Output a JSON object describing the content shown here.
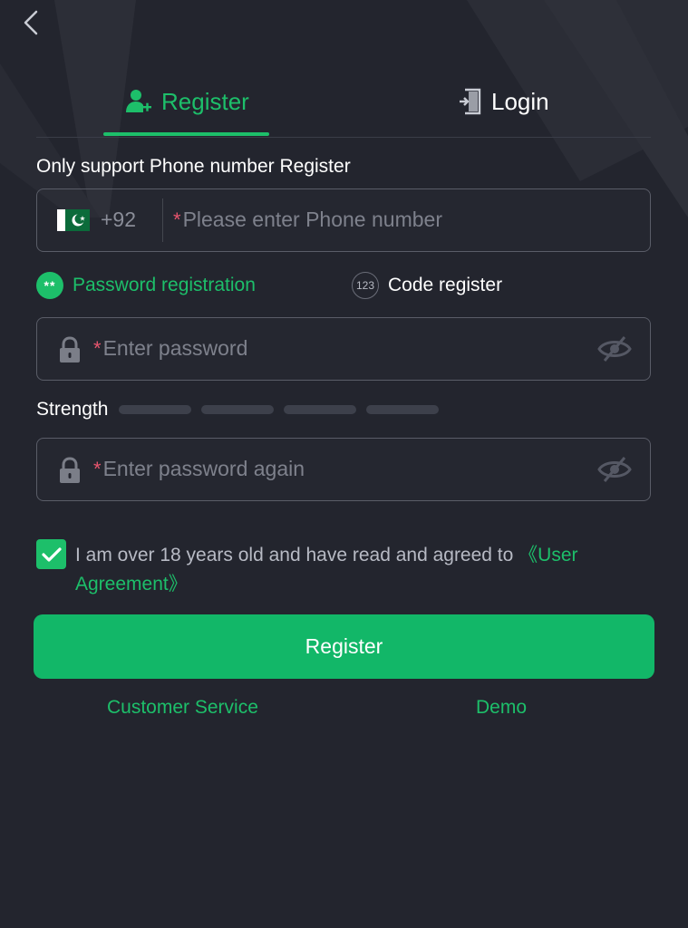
{
  "header": {
    "back_icon": "chevron-left-icon"
  },
  "tabs": [
    {
      "label": "Register",
      "icon": "user-add-icon",
      "active": true
    },
    {
      "label": "Login",
      "icon": "login-door-icon",
      "active": false
    }
  ],
  "form": {
    "support_text": "Only support Phone number Register",
    "phone": {
      "country_flag": "pakistan-flag-icon",
      "country_code": "+92",
      "required_mark": "*",
      "placeholder": "Please enter Phone number"
    },
    "modes": [
      {
        "label": "Password registration",
        "icon_text": "**",
        "selected": true
      },
      {
        "label": "Code register",
        "icon_text": "123",
        "selected": false
      }
    ],
    "password": {
      "required_mark": "*",
      "placeholder": "Enter password"
    },
    "strength": {
      "label": "Strength",
      "level": 0,
      "segments": 4
    },
    "password_again": {
      "required_mark": "*",
      "placeholder": "Enter password again"
    },
    "agreement": {
      "checked": true,
      "text": "I am over 18 years old and have read and agreed to ",
      "link_text": "《User Agreement》"
    },
    "submit_label": "Register"
  },
  "footer": {
    "customer_service": "Customer Service",
    "demo": "Demo"
  },
  "colors": {
    "background": "#23252e",
    "accent": "#1dbf6a",
    "button": "#12b768",
    "required": "#e8556e"
  }
}
